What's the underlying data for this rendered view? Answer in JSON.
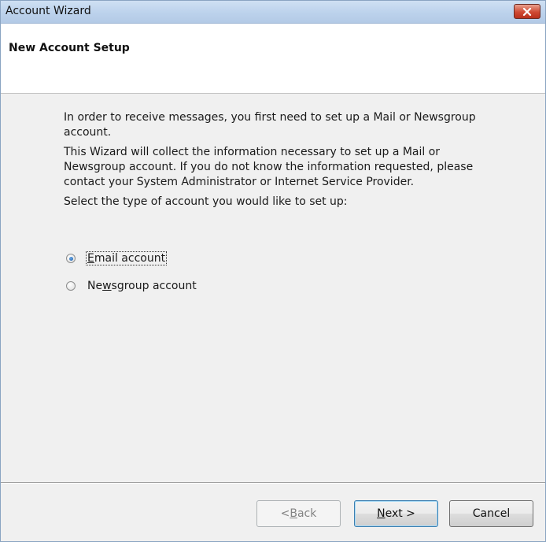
{
  "window": {
    "title": "Account Wizard",
    "close_icon": "close-icon"
  },
  "header": {
    "title": "New Account Setup"
  },
  "content": {
    "para1": "In order to receive messages, you first need to set up a Mail or Newsgroup account.",
    "para2": "This Wizard will collect the information necessary to set up a Mail or Newsgroup account. If you do not know the information requested, please contact your System Administrator or Internet Service Provider.",
    "para3": "Select the type of account you would like to set up:"
  },
  "options": [
    {
      "pre": "",
      "accel": "E",
      "post": "mail account",
      "selected": true
    },
    {
      "pre": "Ne",
      "accel": "w",
      "post": "sgroup account",
      "selected": false
    }
  ],
  "buttons": {
    "back": {
      "pre": "< ",
      "accel": "B",
      "post": "ack",
      "enabled": false
    },
    "next": {
      "pre": "",
      "accel": "N",
      "post": "ext >",
      "enabled": true
    },
    "cancel": {
      "label": "Cancel"
    }
  },
  "colors": {
    "titlebar": "#bcd2ec",
    "close_button": "#cf4a33",
    "radio_selected": "#1f5fa8"
  }
}
